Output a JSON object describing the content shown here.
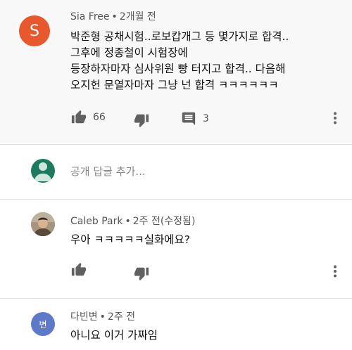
{
  "comments": [
    {
      "author": "Sia Free",
      "time": "2개월 전",
      "avatar_letter": "S",
      "lines": [
        "박준형 공채시험..로보캅개그 등 몇가지로 합격..",
        "그후에 정종철이 시험장에",
        "등장하자마자 심사위원 빵 터지고 합격.. 다음해",
        "오지헌 문열자마자 그냥 넌 합격 ㅋㅋㅋㅋㅋㅋ"
      ],
      "likes": "66",
      "replies": "3"
    },
    {
      "author": "Caleb Park",
      "time": "2주 전(수정됨)",
      "text": "우아 ㅋㅋㅋㅋㅋ실화에요?"
    },
    {
      "author": "다빈변",
      "time": "2주 전",
      "avatar_letter": "변",
      "text": "아니요 이거 가짜임"
    }
  ],
  "reply": {
    "placeholder": "공개 답글 추가..."
  },
  "icons": {
    "like": "thumb-up-icon",
    "dislike": "thumb-down-icon",
    "reply": "comment-icon",
    "more": "more-vert-icon"
  },
  "colors": {
    "avatar_s": "#e8582d",
    "avatar_default": "#1d7a5f",
    "avatar_d": "#5e79c8"
  }
}
